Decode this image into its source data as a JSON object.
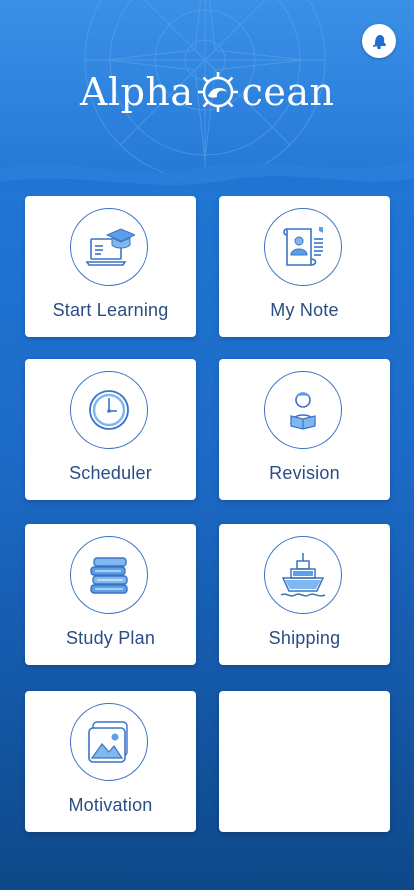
{
  "app": {
    "logo_left": "Alpha",
    "logo_right": "cean"
  },
  "colors": {
    "accent": "#2f86e0",
    "card_text": "#2a4d86",
    "icon_stroke": "#3b73c4"
  },
  "menu": [
    {
      "label": "Start Learning",
      "icon": "laptop-graduation-cap-icon"
    },
    {
      "label": "My Note",
      "icon": "note-scroll-icon"
    },
    {
      "label": "Scheduler",
      "icon": "clock-icon"
    },
    {
      "label": "Revision",
      "icon": "student-reading-icon"
    },
    {
      "label": "Study Plan",
      "icon": "books-stack-icon"
    },
    {
      "label": "Shipping",
      "icon": "ship-icon"
    },
    {
      "label": "Motivation",
      "icon": "picture-gallery-icon"
    },
    {
      "label": "",
      "icon": ""
    }
  ]
}
